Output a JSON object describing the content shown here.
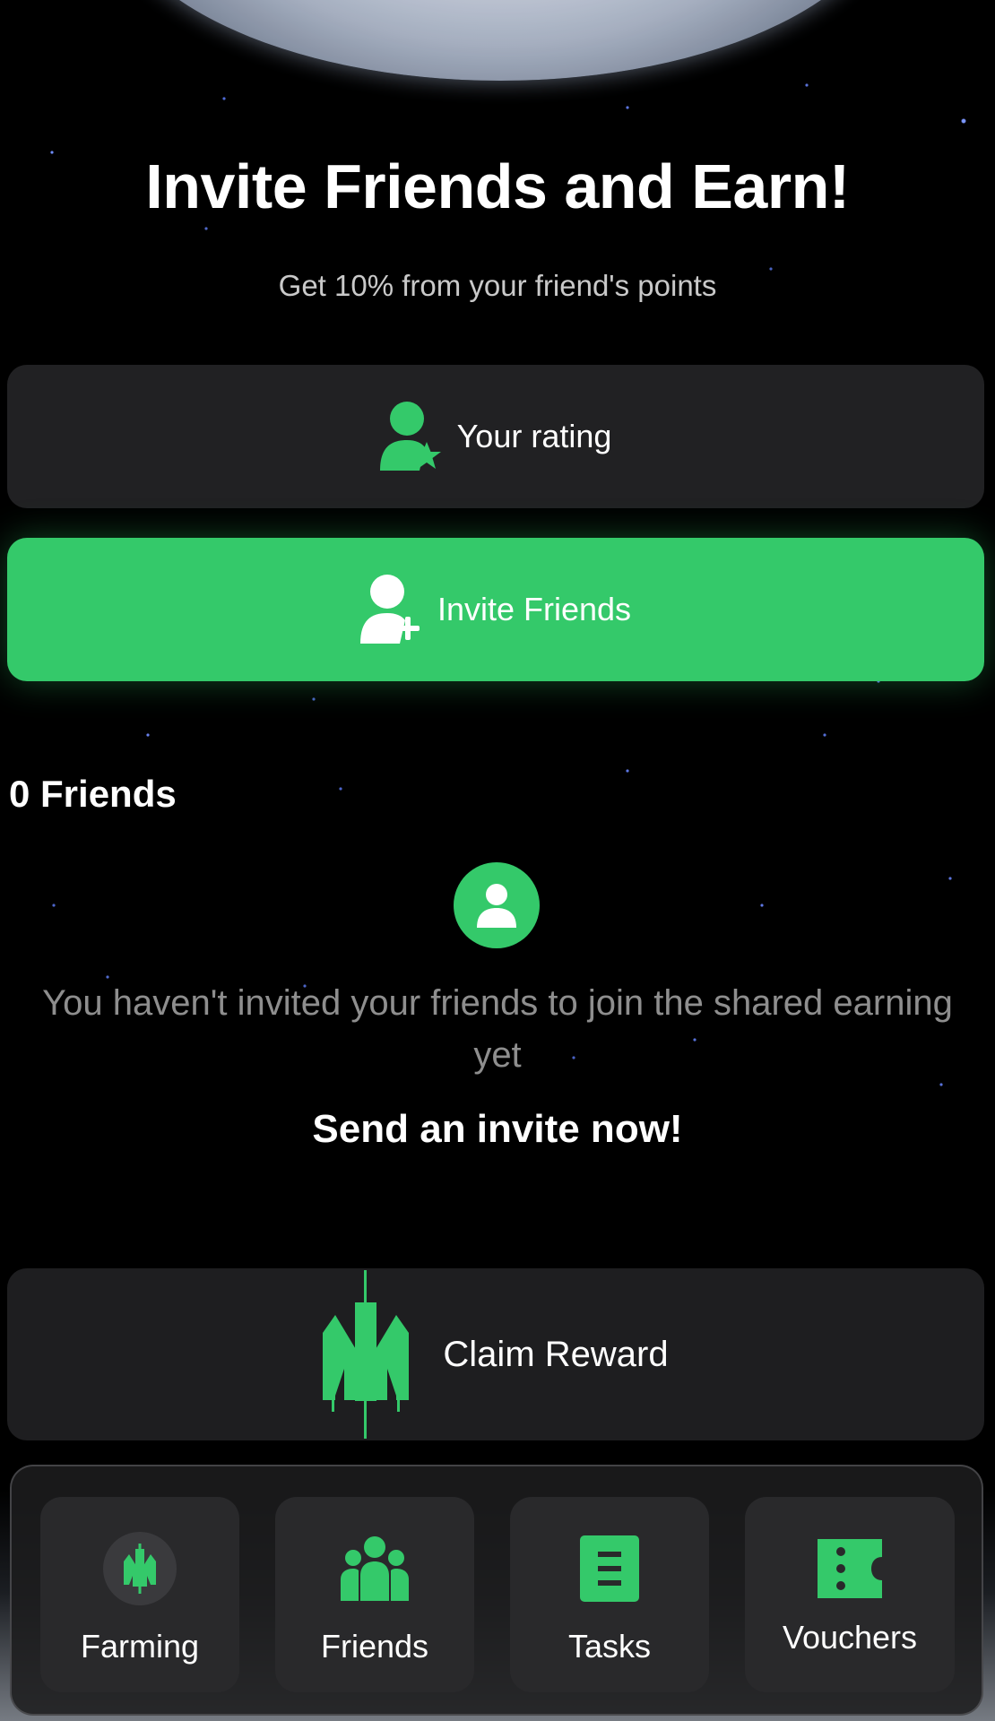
{
  "header": {
    "title": "Invite Friends and Earn!",
    "subtitle": "Get 10% from your friend's points"
  },
  "rating_button": {
    "label": "Your rating",
    "icon": "user-star-icon"
  },
  "invite_button": {
    "label": "Invite Friends",
    "icon": "user-plus-icon"
  },
  "friends": {
    "count_label": "0 Friends",
    "empty_message": "You haven't invited your friends to join the shared earning yet",
    "cta": "Send an invite now!"
  },
  "claim_button": {
    "label": "Claim Reward",
    "icon": "brand-logo-icon"
  },
  "bottom_nav": {
    "items": [
      {
        "label": "Farming",
        "icon": "farming-logo-icon"
      },
      {
        "label": "Friends",
        "icon": "friends-group-icon"
      },
      {
        "label": "Tasks",
        "icon": "document-icon"
      },
      {
        "label": "Vouchers",
        "icon": "ticket-icon"
      }
    ]
  },
  "colors": {
    "accent": "#34c96a",
    "background": "#000000",
    "card": "#212123",
    "muted_text": "#8e8e8e"
  }
}
